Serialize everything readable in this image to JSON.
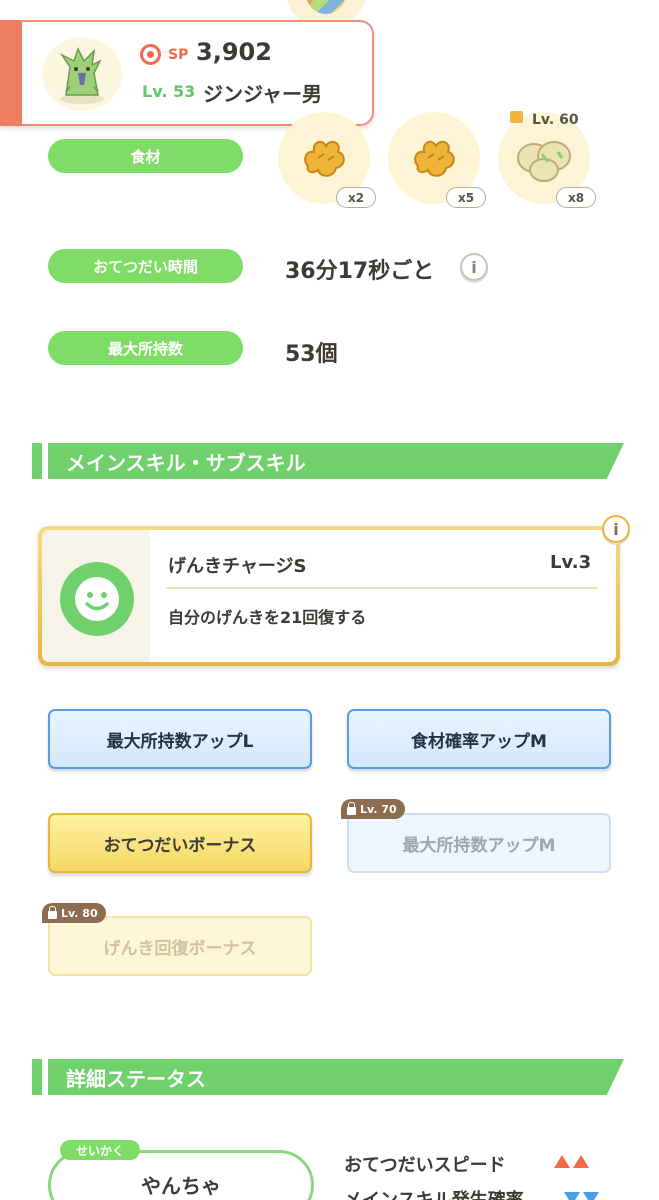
{
  "header": {
    "sp_label": "SP",
    "sp_value": "3,902",
    "level_label": "Lv. 53",
    "pokemon_name": "ジンジャー男"
  },
  "ingredients": {
    "label": "食材",
    "items": [
      {
        "name": "ginger-icon",
        "count": "x2"
      },
      {
        "name": "ginger-icon",
        "count": "x5"
      },
      {
        "name": "soybean-icon",
        "count": "x8",
        "unlock_level": "Lv. 60"
      }
    ]
  },
  "help_time": {
    "label": "おてつだい時間",
    "value": "36分17秒ごと"
  },
  "max_carry": {
    "label": "最大所持数",
    "value": "53個"
  },
  "skills_section": {
    "title": "メインスキル・サブスキル",
    "main_skill": {
      "name": "げんきチャージS",
      "level": "Lv.3",
      "description": "自分のげんきを21回復する"
    },
    "sub_skills": [
      {
        "label": "最大所持数アップL",
        "style": "blue"
      },
      {
        "label": "食材確率アップM",
        "style": "blue"
      },
      {
        "label": "おてつだいボーナス",
        "style": "gold"
      },
      {
        "label": "最大所持数アップM",
        "style": "blue-locked",
        "unlock_level": "Lv. 70"
      },
      {
        "label": "げんき回復ボーナス",
        "style": "gold-locked",
        "unlock_level": "Lv. 80"
      }
    ]
  },
  "details_section": {
    "title": "詳細ステータス",
    "nature_tag": "せいかく",
    "nature_value": "やんちゃ",
    "stats": [
      {
        "label": "おてつだいスピード",
        "effect": "up-up"
      },
      {
        "label": "メインスキル発生確率",
        "effect": "down-down"
      }
    ]
  },
  "colors": {
    "accent_green": "#7fdc67",
    "accent_red": "#f06a4c",
    "gold_border": "#e8b640",
    "blue_border": "#5b9be4"
  }
}
